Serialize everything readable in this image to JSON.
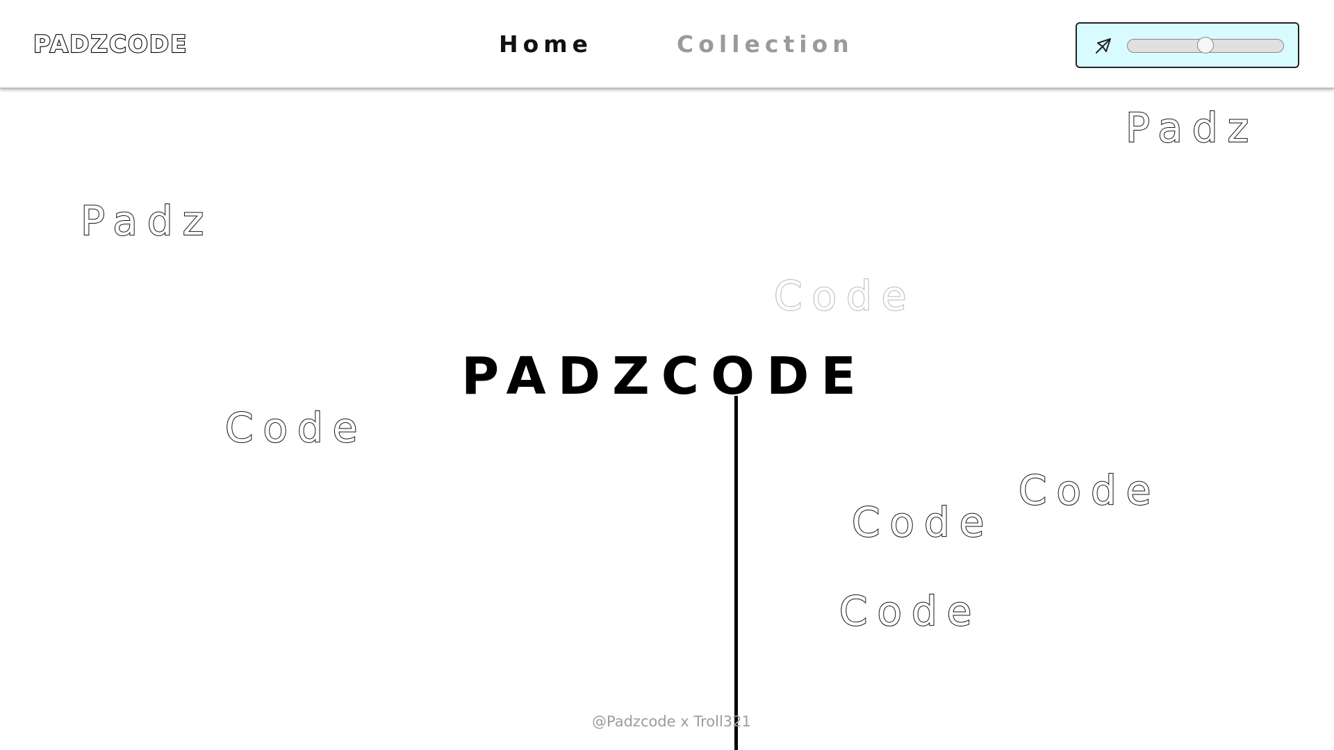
{
  "header": {
    "logo": "PADZCODE",
    "nav": [
      {
        "label": "Home",
        "active": true
      },
      {
        "label": "Collection",
        "active": false
      }
    ],
    "controls": {
      "icon": "send-icon",
      "slider_value": 0.5,
      "panel_color": "#d8fbff"
    }
  },
  "hero": {
    "title": "PADZCODE",
    "floating_words": [
      "Padz",
      "Padz",
      "Code",
      "Code",
      "Code",
      "Code",
      "Code"
    ]
  },
  "footer": {
    "credit": "@Padzcode x Troll321"
  },
  "colors": {
    "background": "#ffffff",
    "text": "#000000",
    "nav_inactive": "#9a9a9a",
    "credit": "#9c9c9c"
  }
}
